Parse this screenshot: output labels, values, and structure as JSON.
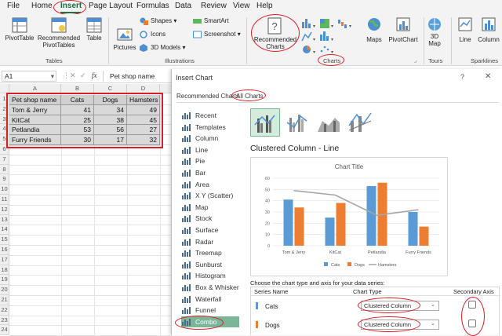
{
  "menu": [
    "File",
    "Home",
    "Insert",
    "Page Layout",
    "Formulas",
    "Data",
    "Review",
    "View",
    "Help"
  ],
  "ribbon": {
    "pivottable": "PivotTable",
    "recommended_pivot": [
      "Recommended",
      "PivotTables"
    ],
    "table": "Table",
    "tables_group": "Tables",
    "pictures": "Pictures",
    "shapes": "Shapes",
    "icons": "Icons",
    "models3d": "3D Models",
    "smartart": "SmartArt",
    "screenshot": "Screenshot",
    "illustrations_group": "Illustrations",
    "recommended_charts": [
      "Recommended",
      "Charts"
    ],
    "maps": "Maps",
    "pivotchart": "PivotChart",
    "charts_group": "Charts",
    "map3d": [
      "3D",
      "Map"
    ],
    "tours_group": "Tours",
    "line": "Line",
    "column": "Column",
    "sparklines_group": "Sparklines"
  },
  "formula_bar": {
    "cell_ref": "A1",
    "formula": "Pet shop name",
    "fx": "fx"
  },
  "sheet": {
    "columns": [
      "A",
      "B",
      "C",
      "D"
    ],
    "rows": [
      "1",
      "2",
      "3",
      "4",
      "5",
      "6",
      "7",
      "8",
      "9",
      "10",
      "11",
      "12",
      "13",
      "14",
      "15",
      "16",
      "17",
      "18",
      "19",
      "20",
      "21",
      "22",
      "23",
      "24"
    ],
    "table": [
      [
        "Pet shop name",
        "Cats",
        "Dogs",
        "Hamsters"
      ],
      [
        "Tom & Jerry",
        "41",
        "34",
        "49"
      ],
      [
        "KitCat",
        "25",
        "38",
        "45"
      ],
      [
        "Petlandia",
        "53",
        "56",
        "27"
      ],
      [
        "Furry Friends",
        "30",
        "17",
        "32"
      ]
    ]
  },
  "dialog": {
    "title": "Insert Chart",
    "help": "?",
    "tabs": [
      "Recommended Charts",
      "All Charts"
    ],
    "chart_types": [
      "Recent",
      "Templates",
      "Column",
      "Line",
      "Pie",
      "Bar",
      "Area",
      "X Y (Scatter)",
      "Map",
      "Stock",
      "Surface",
      "Radar",
      "Treemap",
      "Sunburst",
      "Histogram",
      "Box & Whisker",
      "Waterfall",
      "Funnel",
      "Combo"
    ],
    "selected_type": "Combo",
    "subtype_title": "Clustered Column - Line",
    "series_prompt": "Choose the chart type and axis for your data series:",
    "series_headers": [
      "Series Name",
      "Chart Type",
      "Secondary Axis"
    ],
    "series": [
      {
        "name": "Cats",
        "type": "Clustered Column",
        "color": "#5b9bd5"
      },
      {
        "name": "Dogs",
        "type": "Clustered Column",
        "color": "#ed7d31"
      }
    ]
  },
  "chart_data": {
    "type": "bar",
    "title": "Chart Title",
    "categories": [
      "Tom & Jerry",
      "KitCat",
      "Petlandia",
      "Furry Friends"
    ],
    "series": [
      {
        "name": "Cats",
        "kind": "column",
        "color": "#5b9bd5",
        "values": [
          41,
          25,
          53,
          30
        ]
      },
      {
        "name": "Dogs",
        "kind": "column",
        "color": "#ed7d31",
        "values": [
          34,
          38,
          56,
          17
        ]
      },
      {
        "name": "Hamsters",
        "kind": "line",
        "color": "#a5a5a5",
        "values": [
          49,
          45,
          27,
          32
        ]
      }
    ],
    "yticks": [
      "0",
      "10",
      "20",
      "30",
      "40",
      "50",
      "60"
    ],
    "ylim": [
      0,
      60
    ],
    "grid": true,
    "legend": "bottom"
  },
  "colors": {
    "accent": "#217346",
    "annotation": "#d61f26",
    "selected": "#7bb698"
  }
}
